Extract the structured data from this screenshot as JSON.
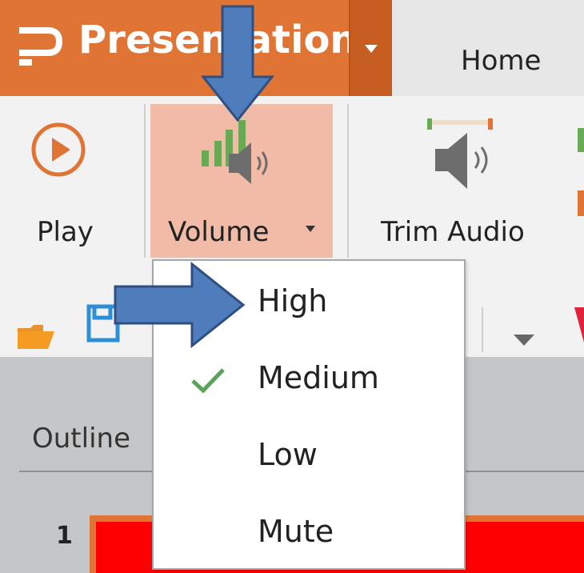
{
  "titlebar": {
    "app_name": "Presentation",
    "app_name_visible": "Presentation",
    "home_tab": "Home"
  },
  "ribbon": {
    "play_label": "Play",
    "volume_label": "Volume",
    "trim_label": "Trim Audio"
  },
  "volume_menu": {
    "items": [
      {
        "label": "High",
        "checked": false
      },
      {
        "label": "Medium",
        "checked": true
      },
      {
        "label": "Low",
        "checked": false
      },
      {
        "label": "Mute",
        "checked": false
      }
    ]
  },
  "outline": {
    "tab_label": "Outline",
    "slide_number": "1"
  },
  "colors": {
    "app_accent": "#e07434",
    "volume_highlight": "#f1bba7",
    "arrow_blue": "#4f7dbc",
    "check_green": "#5aa45a"
  }
}
